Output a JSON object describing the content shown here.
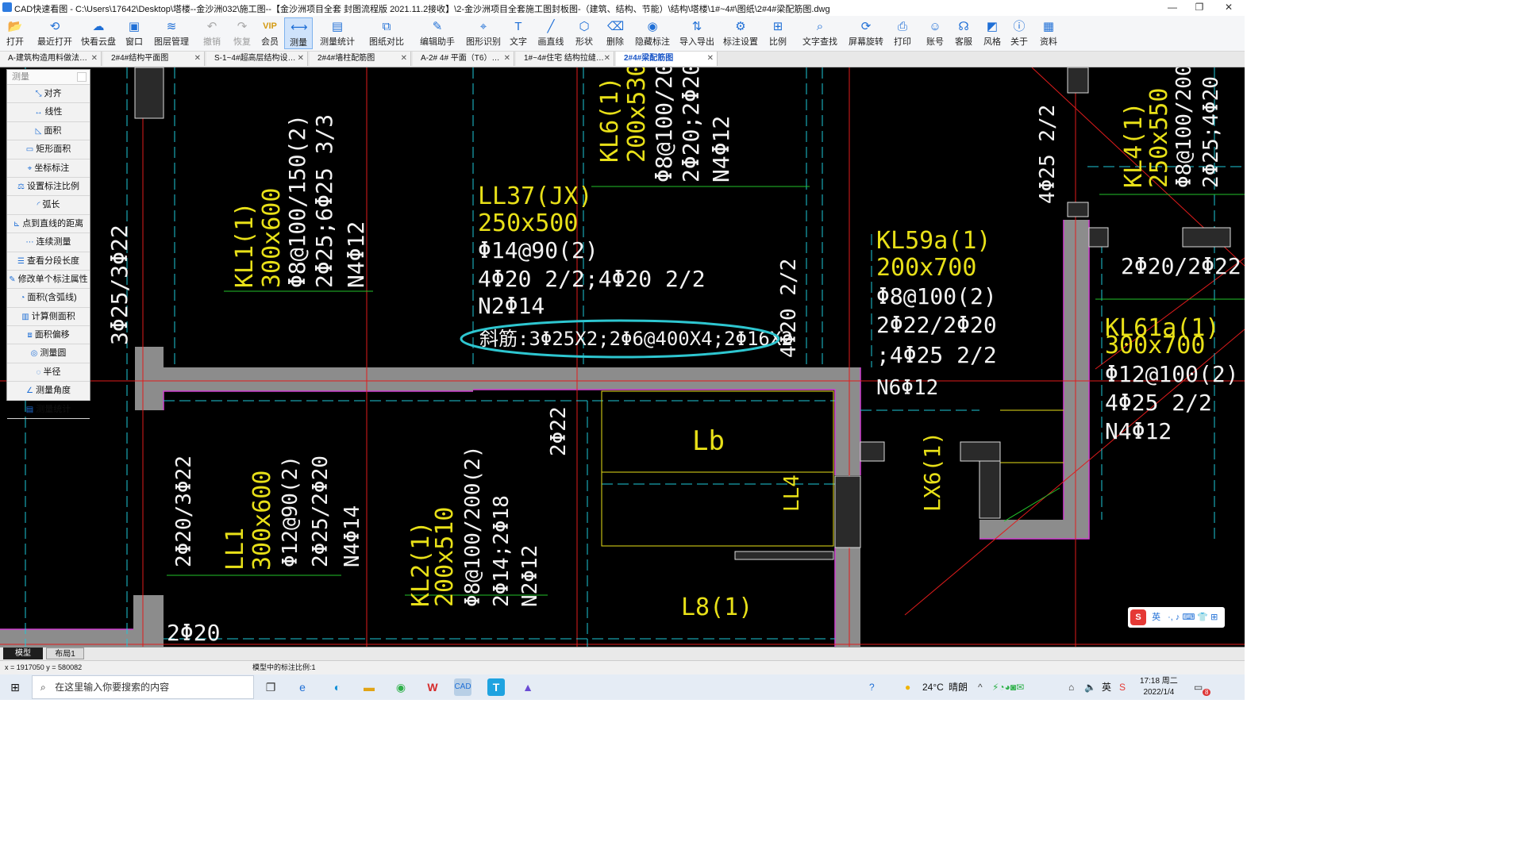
{
  "window": {
    "title": "CAD快速看图 - C:\\Users\\17642\\Desktop\\塔楼--金沙洲032\\施工图--【金沙洲项目全套 封图流程版 2021.11.2接收】\\2-金沙洲项目全套施工图封板图-（建筑、结构、节能）\\结构\\塔楼\\1#~4#\\图纸\\2#4#梁配筋图.dwg",
    "minimize": "—",
    "maximize": "❐",
    "close": "✕"
  },
  "toolbar": [
    {
      "label": "打开",
      "icon": "folder-open-icon",
      "glyph": "📂"
    },
    {
      "label": "最近打开",
      "icon": "clock-icon",
      "glyph": "⟲"
    },
    {
      "label": "快看云盘",
      "icon": "cloud-icon",
      "glyph": "☁"
    },
    {
      "label": "窗口",
      "icon": "window-icon",
      "glyph": "▣"
    },
    {
      "label": "图层管理",
      "icon": "layers-icon",
      "glyph": "≋"
    },
    {
      "label": "撤销",
      "icon": "undo-icon",
      "glyph": "↶",
      "disabled": true
    },
    {
      "label": "恢复",
      "icon": "redo-icon",
      "glyph": "↷",
      "disabled": true
    },
    {
      "label": "会员",
      "icon": "vip-icon",
      "glyph": "VIP",
      "vip": true
    },
    {
      "label": "测量",
      "icon": "measure-icon",
      "glyph": "⟷",
      "active": true
    },
    {
      "label": "测量统计",
      "icon": "measure-stats-icon",
      "glyph": "▤"
    },
    {
      "label": "图纸对比",
      "icon": "compare-icon",
      "glyph": "⧉"
    },
    {
      "label": "编辑助手",
      "icon": "edit-assistant-icon",
      "glyph": "✎"
    },
    {
      "label": "图形识别",
      "icon": "shape-recognize-icon",
      "glyph": "⌖"
    },
    {
      "label": "文字",
      "icon": "text-icon",
      "glyph": "T"
    },
    {
      "label": "画直线",
      "icon": "line-icon",
      "glyph": "╱"
    },
    {
      "label": "形状",
      "icon": "shape-icon",
      "glyph": "⬡"
    },
    {
      "label": "删除",
      "icon": "eraser-icon",
      "glyph": "⌫"
    },
    {
      "label": "隐藏标注",
      "icon": "hide-eye-icon",
      "glyph": "◉"
    },
    {
      "label": "导入导出",
      "icon": "import-export-icon",
      "glyph": "⇅"
    },
    {
      "label": "标注设置",
      "icon": "annotation-settings-icon",
      "glyph": "⚙"
    },
    {
      "label": "比例",
      "icon": "scale-icon",
      "glyph": "⊞"
    },
    {
      "label": "文字查找",
      "icon": "text-search-icon",
      "glyph": "⌕"
    },
    {
      "label": "屏幕旋转",
      "icon": "rotate-icon",
      "glyph": "⟳"
    },
    {
      "label": "打印",
      "icon": "printer-icon",
      "glyph": "⎙"
    },
    {
      "label": "账号",
      "icon": "user-icon",
      "glyph": "☺"
    },
    {
      "label": "客服",
      "icon": "headset-icon",
      "glyph": "☊"
    },
    {
      "label": "风格",
      "icon": "style-icon",
      "glyph": "◩"
    },
    {
      "label": "关于",
      "icon": "info-icon",
      "glyph": "ⓘ"
    },
    {
      "label": "资料",
      "icon": "docs-icon",
      "glyph": "▦"
    }
  ],
  "tabs": [
    {
      "label": "A-建筑构造用料做法…",
      "active": false
    },
    {
      "label": "2#4#结构平面图",
      "active": false
    },
    {
      "label": "S-1~4#超高层结构设…",
      "active": false
    },
    {
      "label": "2#4#墙柱配筋图",
      "active": false
    },
    {
      "label": "A-2# 4# 平面（T6）…",
      "active": false
    },
    {
      "label": "1#~4#住宅 结构拉缝…",
      "active": false
    },
    {
      "label": "2#4#梁配筋图",
      "active": true
    }
  ],
  "measure_panel": {
    "title": "测量",
    "items": [
      {
        "label": "对齐",
        "icon": "align-measure-icon",
        "glyph": "⤡"
      },
      {
        "label": "线性",
        "icon": "linear-measure-icon",
        "glyph": "↔"
      },
      {
        "label": "面积",
        "icon": "area-icon",
        "glyph": "◺"
      },
      {
        "label": "矩形面积",
        "icon": "rect-area-icon",
        "glyph": "▭"
      },
      {
        "label": "坐标标注",
        "icon": "coordinate-icon",
        "glyph": "⌖"
      },
      {
        "label": "设置标注比例",
        "icon": "scale-setting-icon",
        "glyph": "⚖"
      },
      {
        "label": "弧长",
        "icon": "arc-icon",
        "glyph": "◜"
      },
      {
        "label": "点到直线的距离",
        "icon": "point-line-icon",
        "glyph": "⊾"
      },
      {
        "label": "连续测量",
        "icon": "continuous-icon",
        "glyph": "⋯"
      },
      {
        "label": "查看分段长度",
        "icon": "segment-icon",
        "glyph": "☰"
      },
      {
        "label": "修改单个标注属性",
        "icon": "modify-icon",
        "glyph": "✎"
      },
      {
        "label": "面积(含弧线)",
        "icon": "arc-area-icon",
        "glyph": "◔"
      },
      {
        "label": "计算侧面积",
        "icon": "side-area-icon",
        "glyph": "▥"
      },
      {
        "label": "面积偏移",
        "icon": "offset-icon",
        "glyph": "⧈"
      },
      {
        "label": "测量圆",
        "icon": "circle-icon",
        "glyph": "◎"
      },
      {
        "label": "半径",
        "icon": "radius-icon",
        "glyph": "◌"
      },
      {
        "label": "测量角度",
        "icon": "angle-icon",
        "glyph": "∠"
      },
      {
        "label": "测量统计",
        "icon": "stats-icon",
        "glyph": "▤"
      }
    ]
  },
  "drawing": {
    "labels_yellow": [
      "LL37(JX)",
      "250x500",
      "KL1(1)",
      "300x600",
      "KL6(1)",
      "200x530",
      "KL59a(1)",
      "200x700",
      "KL61a(1)",
      "300x700",
      "KL4(1)",
      "250x550",
      "Lb",
      "LL1",
      "300x600",
      "KL2(1)",
      "200x510",
      "L8(1)",
      "LL4",
      "LX6(1)"
    ],
    "labels_white": [
      "Φ14@90(2)",
      "4Φ20 2/2;4Φ20 2/2",
      "N2Φ14",
      "斜筋:3Φ25X2;2Φ6@400X4;2Φ16X2",
      "Φ8@100/150(2)",
      "2Φ25;6Φ25 3/3",
      "N4Φ12",
      "3Φ25/3Φ22",
      "Φ8@100/200",
      "2Φ20;2Φ20/3",
      "N4Φ12",
      "4Φ20 2/2",
      "Φ8@100(2)",
      "2Φ22/2Φ20",
      ";4Φ25 2/2",
      "N6Φ12",
      "4Φ25 2/2",
      "2Φ20/2Φ22",
      "Φ12@100(2)",
      "4Φ25 2/2",
      "N4Φ12",
      "Φ8@100/200(",
      "2Φ25;4Φ20 2",
      "2Φ22",
      "2Φ20/3Φ22",
      "Φ12@90(2)",
      "2Φ25/2Φ20",
      "N4Φ14",
      "Φ8@100/200(2)",
      "2Φ14;2Φ18",
      "N2Φ12",
      "2Φ20"
    ]
  },
  "layout_tabs": [
    {
      "label": "模型",
      "active": true
    },
    {
      "label": "布局1",
      "active": false
    }
  ],
  "status": {
    "coords": "x = 1917050  y = 580082",
    "scale_text": "模型中的标注比例:1"
  },
  "ime": {
    "label": "英",
    "glyphs": "·, ♪ ⌨ 👕 ⊞"
  },
  "taskbar": {
    "search_placeholder": "在这里输入你要搜索的内容",
    "temperature": "24°C",
    "weather": "晴朗",
    "lang": "英",
    "time": "17:18 周二",
    "date": "2022/1/4",
    "notif_count": "8"
  },
  "colors": {
    "cad_bg": "#000000",
    "yellow": "#e8e018",
    "white": "#f2f2f2",
    "red": "#e01c1c",
    "cyan": "#1ec8d8",
    "green": "#22c22a",
    "magenta": "#d040d0",
    "gray_fill": "#8c8c8c",
    "highlight": "#2ec6d0",
    "accent": "#1f6fd6"
  }
}
